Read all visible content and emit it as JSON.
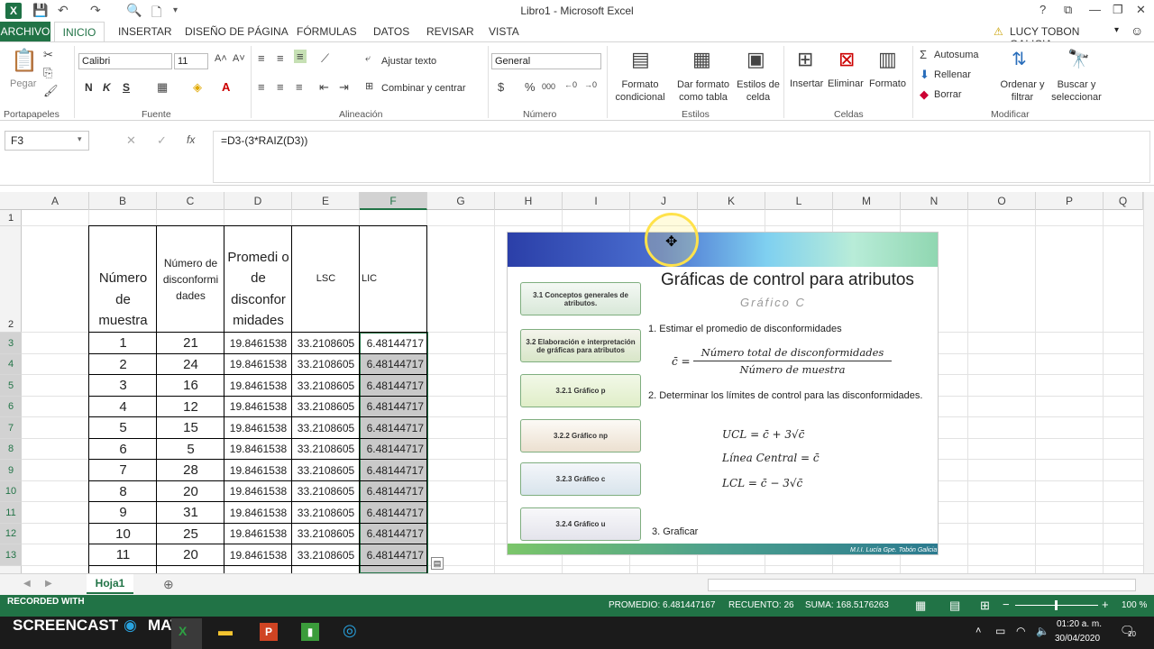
{
  "window": {
    "title": "Libro1 - Microsoft Excel",
    "help": "?",
    "minimize": "—",
    "restore": "❐",
    "close": "✕"
  },
  "tabs": [
    "ARCHIVO",
    "INICIO",
    "INSERTAR",
    "DISEÑO DE PÁGINA",
    "FÓRMULAS",
    "DATOS",
    "REVISAR",
    "VISTA"
  ],
  "user": "LUCY TOBON GALICIA",
  "ribbon": {
    "paste": "Pegar",
    "font": "Calibri",
    "size": "11",
    "bold": "N",
    "italic": "K",
    "underline": "S",
    "wrap": "Ajustar texto",
    "merge": "Combinar y centrar",
    "number_format": "General",
    "cond_format": "Formato condicional",
    "table_format": "Dar formato como tabla",
    "cell_styles": "Estilos de celda",
    "insert": "Insertar",
    "delete": "Eliminar",
    "format": "Formato",
    "autosum": "Autosuma",
    "fill": "Rellenar",
    "clear": "Borrar",
    "sort": "Ordenar y filtrar",
    "find": "Buscar y seleccionar",
    "groups": [
      "Portapapeles",
      "Fuente",
      "Alineación",
      "Número",
      "Estilos",
      "Celdas",
      "Modificar"
    ]
  },
  "namebox": "F3",
  "formula": "=D3-(3*RAIZ(D3))",
  "columns": [
    "A",
    "B",
    "C",
    "D",
    "E",
    "F",
    "G",
    "H",
    "I",
    "J",
    "K",
    "L",
    "M",
    "N",
    "O",
    "P",
    "Q"
  ],
  "rows": [
    "1",
    "2",
    "3",
    "4",
    "5",
    "6",
    "7",
    "8",
    "9",
    "10",
    "11",
    "12",
    "13"
  ],
  "headers": {
    "b": "Número de muestra",
    "c": "Número de disconformi dades",
    "d": "Promedi o de disconfor midades",
    "e": "LSC",
    "f": "LIC"
  },
  "data": [
    {
      "b": "1",
      "c": "21",
      "d": "19.8461538",
      "e": "33.2108605",
      "f": "6.48144717"
    },
    {
      "b": "2",
      "c": "24",
      "d": "19.8461538",
      "e": "33.2108605",
      "f": "6.48144717"
    },
    {
      "b": "3",
      "c": "16",
      "d": "19.8461538",
      "e": "33.2108605",
      "f": "6.48144717"
    },
    {
      "b": "4",
      "c": "12",
      "d": "19.8461538",
      "e": "33.2108605",
      "f": "6.48144717"
    },
    {
      "b": "5",
      "c": "15",
      "d": "19.8461538",
      "e": "33.2108605",
      "f": "6.48144717"
    },
    {
      "b": "6",
      "c": "5",
      "d": "19.8461538",
      "e": "33.2108605",
      "f": "6.48144717"
    },
    {
      "b": "7",
      "c": "28",
      "d": "19.8461538",
      "e": "33.2108605",
      "f": "6.48144717"
    },
    {
      "b": "8",
      "c": "20",
      "d": "19.8461538",
      "e": "33.2108605",
      "f": "6.48144717"
    },
    {
      "b": "9",
      "c": "31",
      "d": "19.8461538",
      "e": "33.2108605",
      "f": "6.48144717"
    },
    {
      "b": "10",
      "c": "25",
      "d": "19.8461538",
      "e": "33.2108605",
      "f": "6.48144717"
    },
    {
      "b": "11",
      "c": "20",
      "d": "19.8461538",
      "e": "33.2108605",
      "f": "6.48144717"
    }
  ],
  "slide": {
    "title": "Gráficas de control para atributos",
    "subtitle": "Gráfico C",
    "steps": [
      "3.1 Conceptos generales de atributos.",
      "3.2 Elaboración e interpretación de gráficas para atributos",
      "3.2.1 Gráfico p",
      "3.2.2 Gráfico np",
      "3.2.3 Gráfico c",
      "3.2.4 Gráfico u"
    ],
    "item1": "1. Estimar el promedio de disconformidades",
    "cbar": "c̄ =",
    "numerator": "Número total de disconformidades",
    "denominator": "Número de muestra",
    "item2": "2. Determinar los límites de control para las disconformidades.",
    "ucl": "UCL = c̄ + 3√c̄",
    "central": "Línea Central = c̄",
    "lcl": "LCL = c̄ − 3√c̄",
    "item3": "3. Graficar",
    "author": "M.I.I. Lucía Gpe. Tobón Galicia"
  },
  "sheet": "Hoja1",
  "status": {
    "promedio": "PROMEDIO: 6.481447167",
    "recuento": "RECUENTO: 26",
    "suma": "SUMA: 168.5176263",
    "zoom": "100 %"
  },
  "taskbar": {
    "recorded": "RECORDED WITH",
    "brand": "SCREENCAST",
    "brand2": "MATIC",
    "time": "01:20 a. m.",
    "date": "30/04/2020",
    "notif": "20"
  },
  "colors": {
    "excel_green": "#217346",
    "selection": "#217346"
  }
}
